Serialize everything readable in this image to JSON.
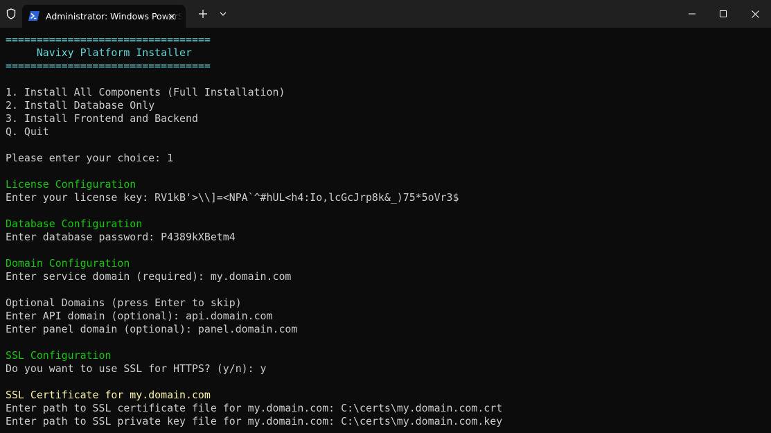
{
  "window": {
    "tab_title": "Administrator: Windows PowerShell",
    "colors": {
      "titlebar": "#202020",
      "terminal_bg": "#0c0c0c",
      "text": "#cccccc",
      "cyan": "#61d6d6",
      "green": "#16c60c",
      "yellow": "#f9f1a5"
    }
  },
  "terminal": {
    "lines": [
      {
        "text": "=================================",
        "color": "cyan"
      },
      {
        "text": "     Navixy Platform Installer",
        "color": "cyan"
      },
      {
        "text": "=================================",
        "color": "cyan"
      },
      {
        "text": "",
        "color": "white"
      },
      {
        "text": "1. Install All Components (Full Installation)",
        "color": "white"
      },
      {
        "text": "2. Install Database Only",
        "color": "white"
      },
      {
        "text": "3. Install Frontend and Backend",
        "color": "white"
      },
      {
        "text": "Q. Quit",
        "color": "white"
      },
      {
        "text": "",
        "color": "white"
      },
      {
        "text": "Please enter your choice: 1",
        "color": "white"
      },
      {
        "text": "",
        "color": "white"
      },
      {
        "text": "License Configuration",
        "color": "green"
      },
      {
        "text": "Enter your license key: RV1kB'>\\\\]=<NPA`^#hUL<h4:Io,lcGcJrp8k&_)75*5oVr3$",
        "color": "white"
      },
      {
        "text": "",
        "color": "white"
      },
      {
        "text": "Database Configuration",
        "color": "green"
      },
      {
        "text": "Enter database password: P4389kXBetm4",
        "color": "white"
      },
      {
        "text": "",
        "color": "white"
      },
      {
        "text": "Domain Configuration",
        "color": "green"
      },
      {
        "text": "Enter service domain (required): my.domain.com",
        "color": "white"
      },
      {
        "text": "",
        "color": "white"
      },
      {
        "text": "Optional Domains (press Enter to skip)",
        "color": "white"
      },
      {
        "text": "Enter API domain (optional): api.domain.com",
        "color": "white"
      },
      {
        "text": "Enter panel domain (optional): panel.domain.com",
        "color": "white"
      },
      {
        "text": "",
        "color": "white"
      },
      {
        "text": "SSL Configuration",
        "color": "green"
      },
      {
        "text": "Do you want to use SSL for HTTPS? (y/n): y",
        "color": "white"
      },
      {
        "text": "",
        "color": "white"
      },
      {
        "text": "SSL Certificate for my.domain.com",
        "color": "yellow"
      },
      {
        "text": "Enter path to SSL certificate file for my.domain.com: C:\\certs\\my.domain.com.crt",
        "color": "white"
      },
      {
        "text": "Enter path to SSL private key file for my.domain.com: C:\\certs\\my.domain.com.key",
        "color": "white"
      }
    ]
  }
}
